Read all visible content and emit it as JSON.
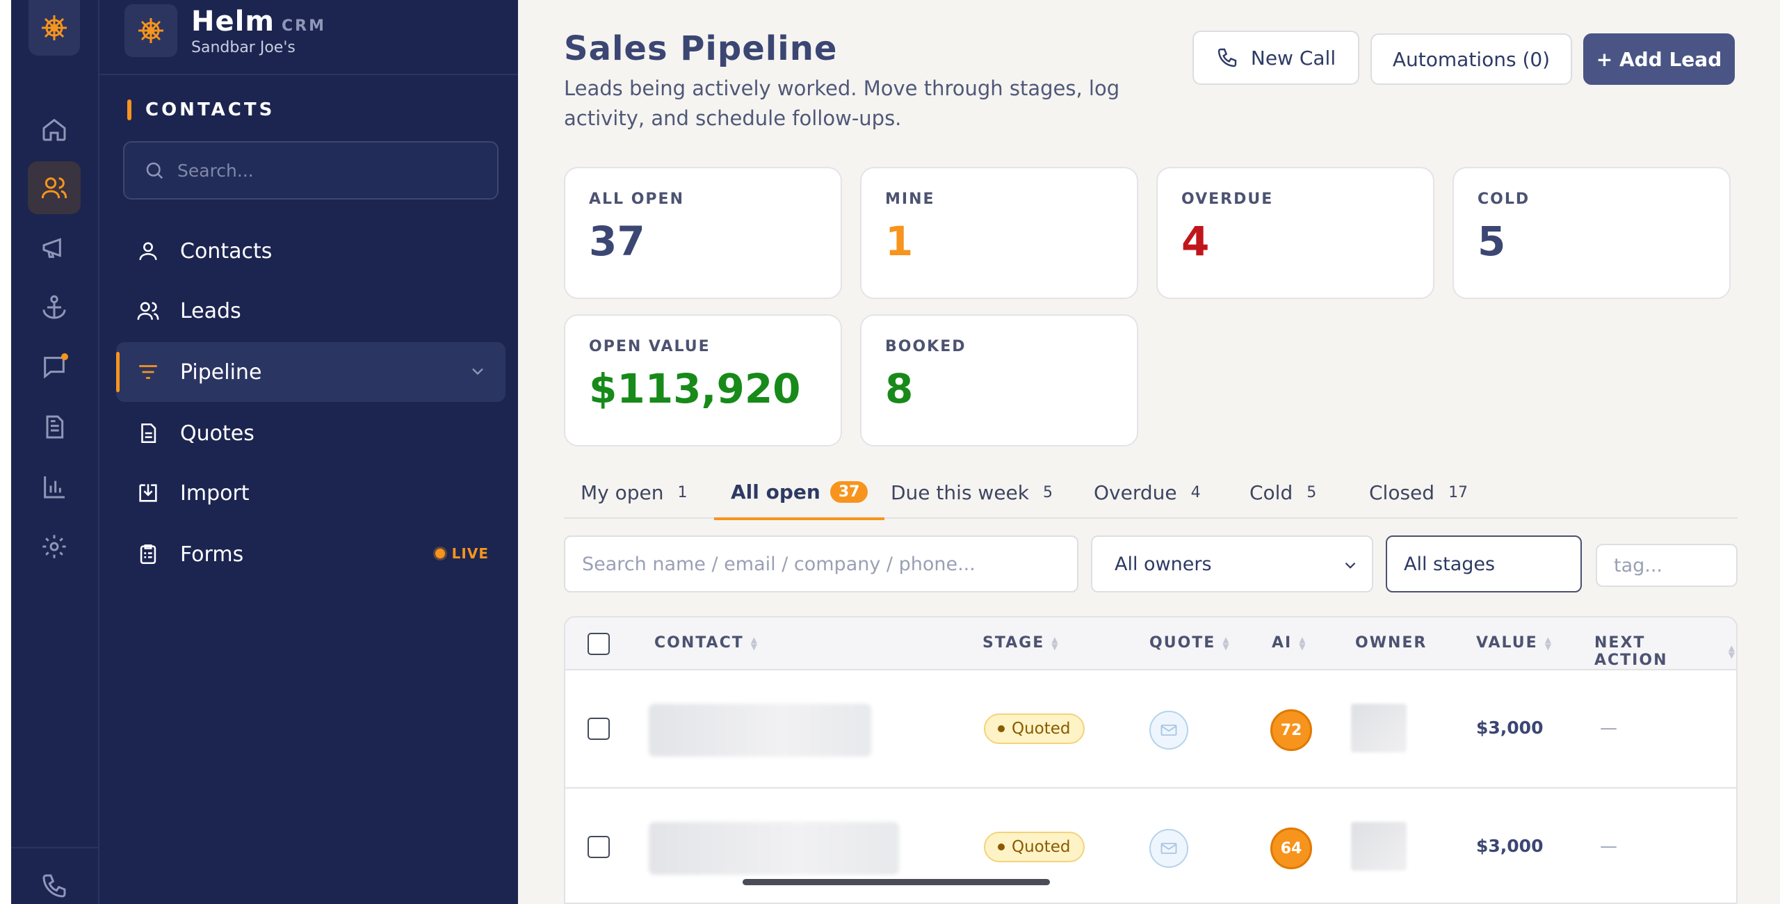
{
  "app": {
    "name": "Helm",
    "product": "CRM",
    "tenant": "Sandbar Joe's"
  },
  "rail": {
    "icons": [
      "home-icon",
      "users-icon",
      "megaphone-icon",
      "anchor-icon",
      "chat-icon",
      "document-icon",
      "bar-chart-icon",
      "gear-icon",
      "phone-icon"
    ],
    "active": "users-icon"
  },
  "sidebar": {
    "section_title": "CONTACTS",
    "search_placeholder": "Search...",
    "items": [
      {
        "label": "Contacts",
        "icon": "user-icon"
      },
      {
        "label": "Leads",
        "icon": "users-icon"
      },
      {
        "label": "Pipeline",
        "icon": "filter-icon",
        "active": true
      },
      {
        "label": "Quotes",
        "icon": "document-icon"
      },
      {
        "label": "Import",
        "icon": "download-icon"
      },
      {
        "label": "Forms",
        "icon": "clipboard-icon",
        "badge": "LIVE"
      }
    ]
  },
  "header": {
    "title": "Sales Pipeline",
    "subtitle": "Leads being actively worked. Move through stages, log activity, and schedule follow-ups.",
    "new_call": "New Call",
    "automations": "Automations (0)",
    "add_lead": "+ Add Lead"
  },
  "stats": [
    {
      "label": "ALL OPEN",
      "value": "37",
      "color": "#3b4673"
    },
    {
      "label": "MINE",
      "value": "1",
      "color": "#f7941d"
    },
    {
      "label": "OVERDUE",
      "value": "4",
      "color": "#c0161b"
    },
    {
      "label": "COLD",
      "value": "5",
      "color": "#3b4673"
    },
    {
      "label": "OPEN VALUE",
      "value": "$113,920",
      "color": "#178a1a"
    },
    {
      "label": "BOOKED",
      "value": "8",
      "color": "#178a1a"
    }
  ],
  "tabs": [
    {
      "label": "My open",
      "count": "1"
    },
    {
      "label": "All open",
      "count": "37",
      "active": true
    },
    {
      "label": "Due this week",
      "count": "5"
    },
    {
      "label": "Overdue",
      "count": "4"
    },
    {
      "label": "Cold",
      "count": "5"
    },
    {
      "label": "Closed",
      "count": "17"
    }
  ],
  "filters": {
    "search_placeholder": "Search name / email / company / phone...",
    "owner": "All owners",
    "stage": "All stages",
    "tag_placeholder": "tag..."
  },
  "table": {
    "columns": [
      "CONTACT",
      "STAGE",
      "QUOTE",
      "AI",
      "OWNER",
      "VALUE",
      "NEXT ACTION"
    ],
    "rows": [
      {
        "stage": "Quoted",
        "ai": "72",
        "value": "$3,000",
        "next": "—"
      },
      {
        "stage": "Quoted",
        "ai": "64",
        "value": "$3,000",
        "next": "—"
      }
    ]
  }
}
